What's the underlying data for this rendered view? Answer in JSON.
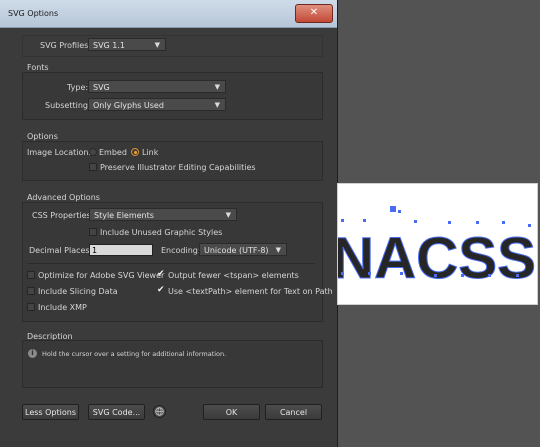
{
  "window": {
    "title": "SVG Options",
    "close_glyph": "✕"
  },
  "profiles": {
    "label": "SVG Profiles:",
    "value": "SVG 1.1"
  },
  "fonts": {
    "heading": "Fonts",
    "type_label": "Type:",
    "type_value": "SVG",
    "subsetting_label": "Subsetting:",
    "subsetting_value": "Only Glyphs Used"
  },
  "options": {
    "heading": "Options",
    "image_location_label": "Image Location:",
    "embed_label": "Embed",
    "link_label": "Link",
    "selected": "Link",
    "preserve_label": "Preserve Illustrator Editing Capabilities",
    "preserve_checked": false
  },
  "advanced": {
    "heading": "Advanced Options",
    "css_label": "CSS Properties:",
    "css_value": "Style Elements",
    "unused_styles_label": "Include Unused Graphic Styles",
    "unused_styles_checked": false,
    "decimal_label": "Decimal Places:",
    "decimal_value": "1",
    "encoding_label": "Encoding:",
    "encoding_value": "Unicode (UTF-8)",
    "optimize_label": "Optimize for Adobe SVG Viewer",
    "optimize_checked": false,
    "slicing_label": "Include Slicing Data",
    "slicing_checked": false,
    "xmp_label": "Include XMP",
    "xmp_checked": false,
    "tspan_label": "Output fewer <tspan> elements",
    "tspan_checked": true,
    "textpath_label": "Use <textPath> element for Text on Path",
    "textpath_checked": true
  },
  "description": {
    "heading": "Description",
    "text": "Hold the cursor over a setting for additional information.",
    "icon": "info-icon"
  },
  "buttons": {
    "less_options": "Less Options",
    "svg_code": "SVG Code...",
    "web_icon": "globe-icon",
    "ok": "OK",
    "cancel": "Cancel"
  },
  "preview": {
    "text": "NACSS"
  },
  "colors": {
    "accent": "#f0a030",
    "selection": "#4a6cf0"
  }
}
